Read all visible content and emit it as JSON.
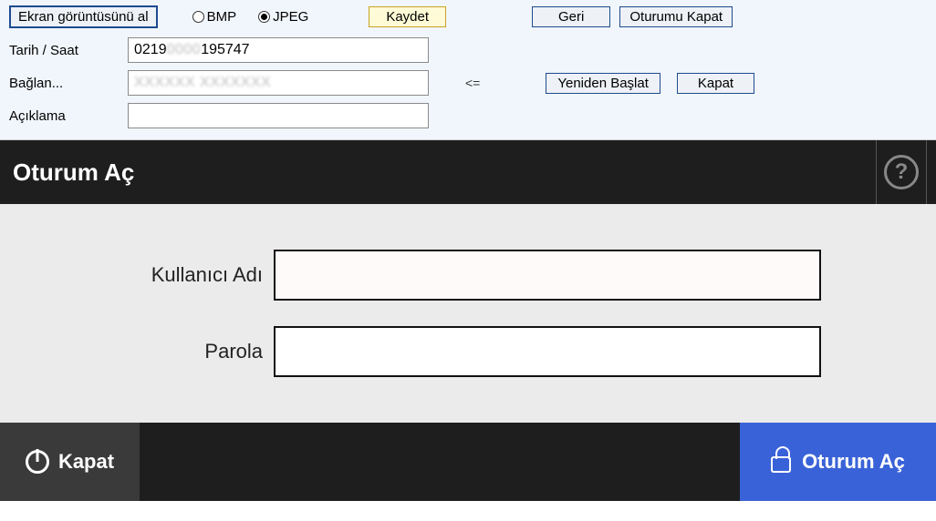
{
  "toolbar": {
    "screenshot_button": "Ekran görüntüsünü al",
    "format_bmp": "BMP",
    "format_jpeg": "JPEG",
    "selected_format": "jpeg",
    "save_button": "Kaydet",
    "back_button": "Geri",
    "logout_button": "Oturumu Kapat"
  },
  "form": {
    "datetime_label": "Tarih / Saat",
    "datetime_value_prefix": "0219",
    "datetime_value_suffix": "195747",
    "connect_label": "Bağlan...",
    "connect_value": "",
    "arrow": "<=",
    "restart_button": "Yeniden Başlat",
    "close_button": "Kapat",
    "description_label": "Açıklama",
    "description_value": ""
  },
  "login": {
    "header_title": "Oturum Aç",
    "help_symbol": "?",
    "username_label": "Kullanıcı Adı",
    "username_value": "",
    "password_label": "Parola",
    "password_value": ""
  },
  "bottombar": {
    "close_label": "Kapat",
    "login_label": "Oturum Aç"
  }
}
